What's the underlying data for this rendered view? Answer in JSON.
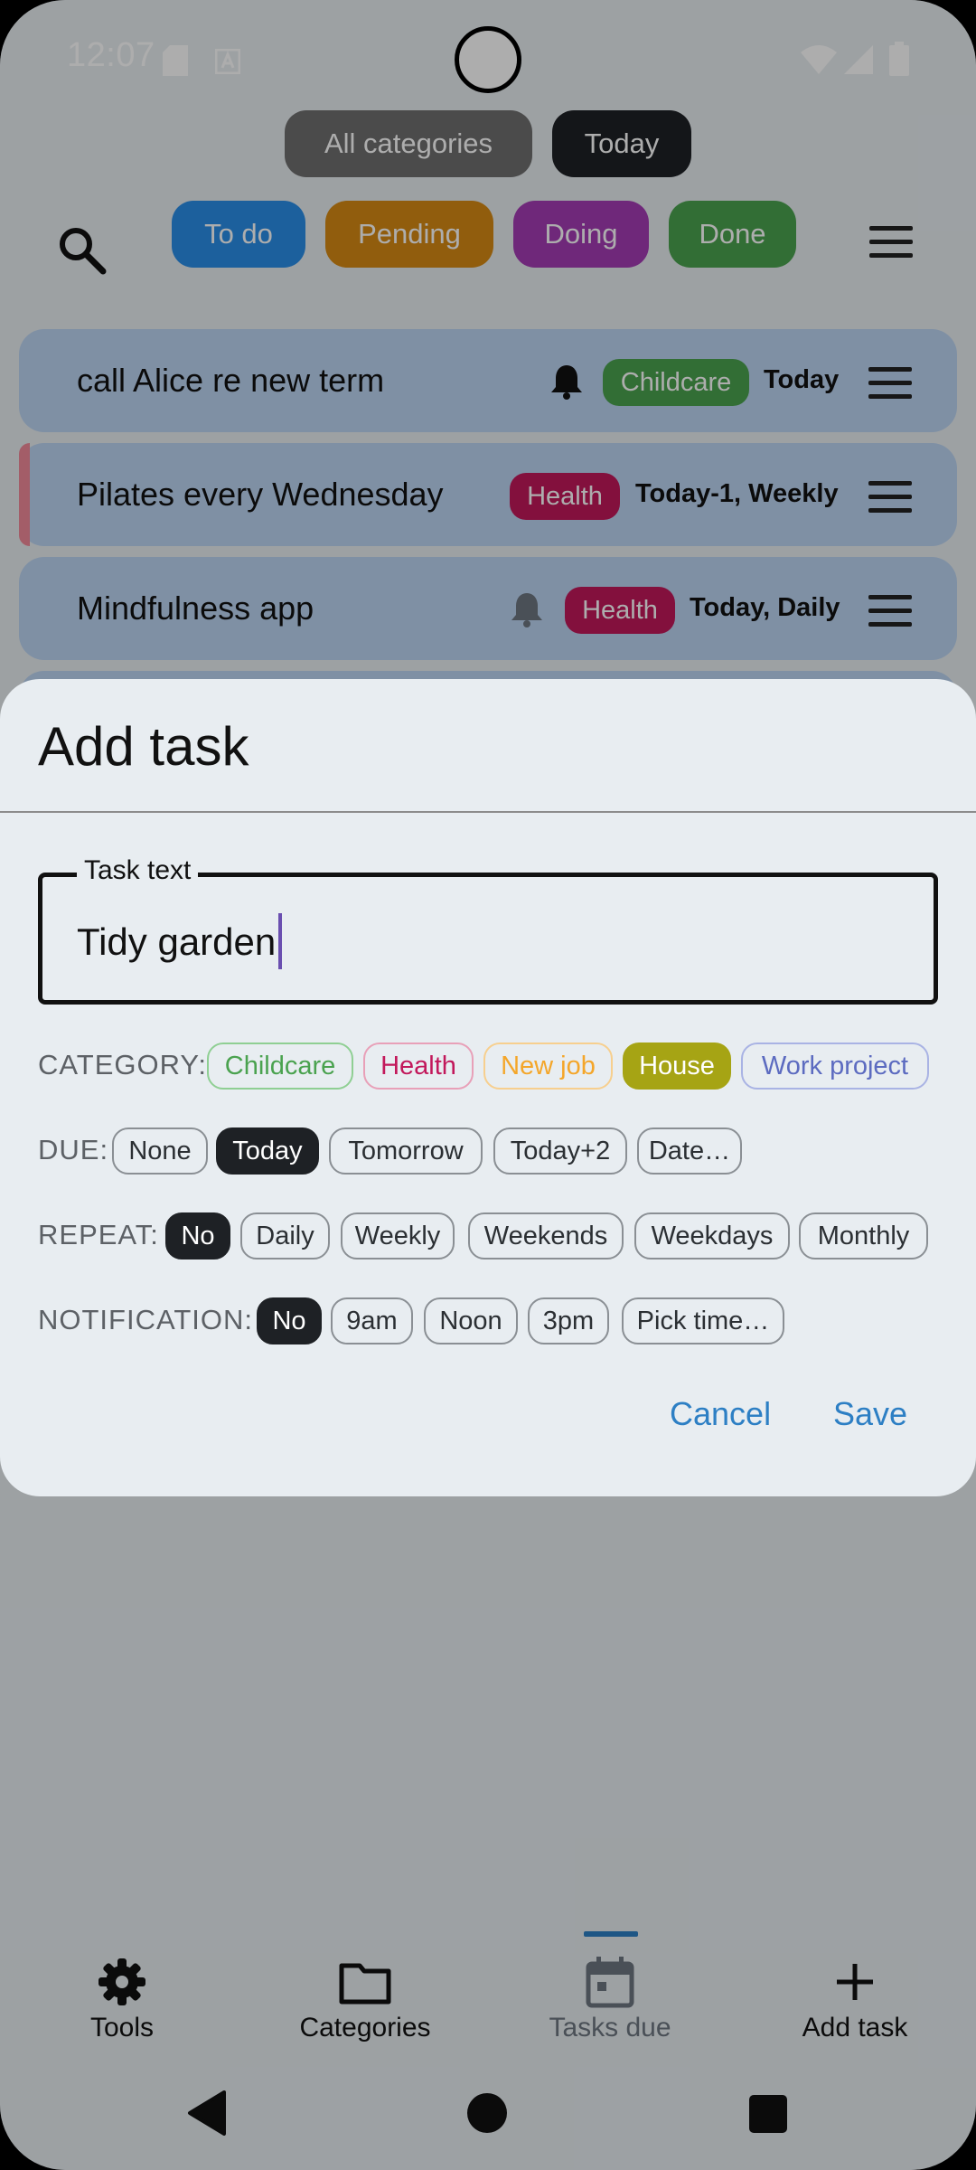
{
  "status_bar": {
    "time": "12:07"
  },
  "top_filters": {
    "scope": [
      "All categories",
      "Today"
    ],
    "states": [
      "To do",
      "Pending",
      "Doing",
      "Done"
    ]
  },
  "tasks": [
    {
      "text": "call Alice re new term",
      "category": "Childcare",
      "due": "Today"
    },
    {
      "text": "Pilates every Wednesday",
      "category": "Health",
      "due": "Today-1, Weekly"
    },
    {
      "text": "Mindfulness app",
      "category": "Health",
      "due": "Today, Daily"
    }
  ],
  "dialog": {
    "title": "Add task",
    "field_label": "Task text",
    "field_value": "Tidy garden",
    "category_label": "CATEGORY:",
    "categories": [
      "Childcare",
      "Health",
      "New job",
      "House",
      "Work project"
    ],
    "due_label": "DUE:",
    "due_options": [
      "None",
      "Today",
      "Tomorrow",
      "Today+2",
      "Date…"
    ],
    "repeat_label": "REPEAT:",
    "repeat_options": [
      "No",
      "Daily",
      "Weekly",
      "Weekends",
      "Weekdays",
      "Monthly"
    ],
    "notification_label": "NOTIFICATION:",
    "notification_options": [
      "No",
      "9am",
      "Noon",
      "3pm",
      "Pick time…"
    ],
    "cancel": "Cancel",
    "save": "Save"
  },
  "bottom_nav": [
    "Tools",
    "Categories",
    "Tasks due",
    "Add task"
  ],
  "colors": {
    "todo": "#2a8ee8",
    "pending": "#d68a14",
    "doing": "#a43bb4",
    "done": "#4aa24f",
    "childcare": "#4aa24f",
    "health": "#c2185b",
    "new_job": "#f4a62a",
    "house": "#a6a414",
    "work_project": "#5c6bc0",
    "accent": "#2d7fc4"
  }
}
